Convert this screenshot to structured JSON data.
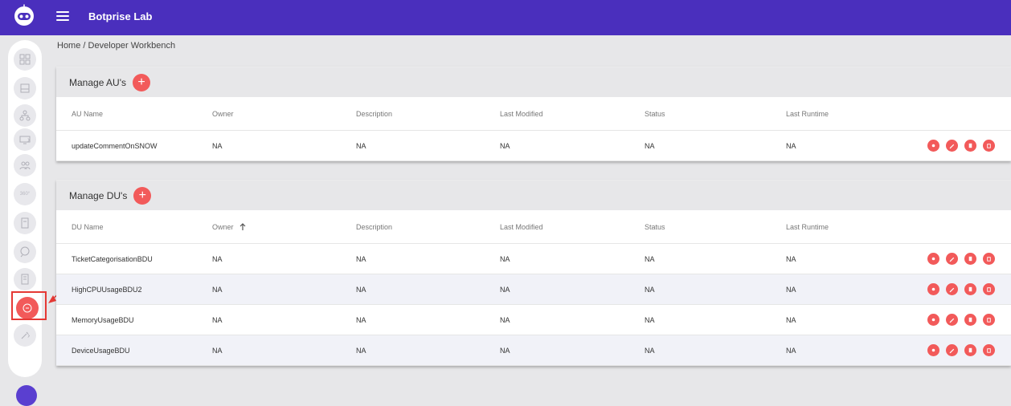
{
  "app": {
    "title": "Botprise Lab"
  },
  "breadcrumb": {
    "text": "Home / Developer Workbench"
  },
  "sidebar": {
    "items": [
      "dashboard-icon",
      "inbox-icon",
      "hierarchy-icon",
      "monitor-icon",
      "users-icon",
      "360-icon",
      "document-icon",
      "chat-search-icon",
      "notes-icon",
      "chat-active-icon",
      "tools-icon"
    ],
    "label_360": "360°"
  },
  "colors": {
    "topbar": "#4a2fbd",
    "accent": "#f25a5a",
    "highlight": "#e53935"
  },
  "au_section": {
    "title": "Manage AU's",
    "add_label": "+",
    "columns": [
      "AU Name",
      "Owner",
      "Description",
      "Last Modified",
      "Status",
      "Last Runtime"
    ],
    "rows": [
      {
        "name": "updateCommentOnSNOW",
        "owner": "NA",
        "description": "NA",
        "last_modified": "NA",
        "status": "NA",
        "last_runtime": "NA"
      }
    ]
  },
  "du_section": {
    "title": "Manage DU's",
    "add_label": "+",
    "columns": [
      "DU Name",
      "Owner",
      "Description",
      "Last Modified",
      "Status",
      "Last Runtime"
    ],
    "rows": [
      {
        "name": "TicketCategorisationBDU",
        "owner": "NA",
        "description": "NA",
        "last_modified": "NA",
        "status": "NA",
        "last_runtime": "NA"
      },
      {
        "name": "HighCPUUsageBDU2",
        "owner": "NA",
        "description": "NA",
        "last_modified": "NA",
        "status": "NA",
        "last_runtime": "NA"
      },
      {
        "name": "MemoryUsageBDU",
        "owner": "NA",
        "description": "NA",
        "last_modified": "NA",
        "status": "NA",
        "last_runtime": "NA"
      },
      {
        "name": "DeviceUsageBDU",
        "owner": "NA",
        "description": "NA",
        "last_modified": "NA",
        "status": "NA",
        "last_runtime": "NA"
      }
    ]
  }
}
